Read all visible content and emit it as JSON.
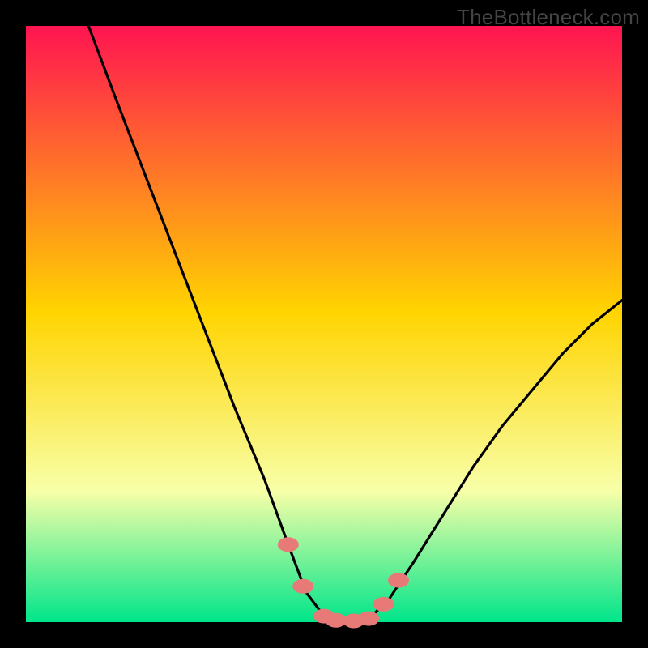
{
  "attribution": "TheBottleneck.com",
  "chart_data": {
    "type": "line",
    "title": "",
    "xlabel": "",
    "ylabel": "",
    "xlim": [
      0,
      100
    ],
    "ylim": [
      0,
      100
    ],
    "series": [
      {
        "name": "bottleneck-curve",
        "x": [
          10.5,
          15,
          20,
          25,
          30,
          35,
          40,
          44,
          47,
          50,
          53,
          56,
          58,
          61,
          65,
          70,
          75,
          80,
          85,
          90,
          95,
          100
        ],
        "y": [
          100,
          88,
          75,
          62,
          49,
          36,
          24,
          13,
          5,
          1,
          0,
          0,
          1,
          4,
          10,
          18,
          26,
          33,
          39,
          45,
          50,
          54
        ]
      }
    ],
    "markers": [
      {
        "name": "marker-left-upper",
        "x": 44.0,
        "y": 13.0
      },
      {
        "name": "marker-left-lower",
        "x": 46.5,
        "y": 6.0
      },
      {
        "name": "marker-floor-1",
        "x": 50.0,
        "y": 1.0
      },
      {
        "name": "marker-floor-2",
        "x": 52.0,
        "y": 0.3
      },
      {
        "name": "marker-floor-3",
        "x": 55.0,
        "y": 0.2
      },
      {
        "name": "marker-floor-4",
        "x": 57.5,
        "y": 0.6
      },
      {
        "name": "marker-right-lower",
        "x": 60.0,
        "y": 3.0
      },
      {
        "name": "marker-right-upper",
        "x": 62.5,
        "y": 7.0
      }
    ],
    "colors": {
      "gradient_top": "#ff1451",
      "gradient_mid": "#ffd400",
      "gradient_low": "#f8ffa8",
      "gradient_bottom": "#00e58a",
      "curve": "#000000",
      "marker_fill": "#e77a77",
      "frame": "#000000"
    }
  }
}
